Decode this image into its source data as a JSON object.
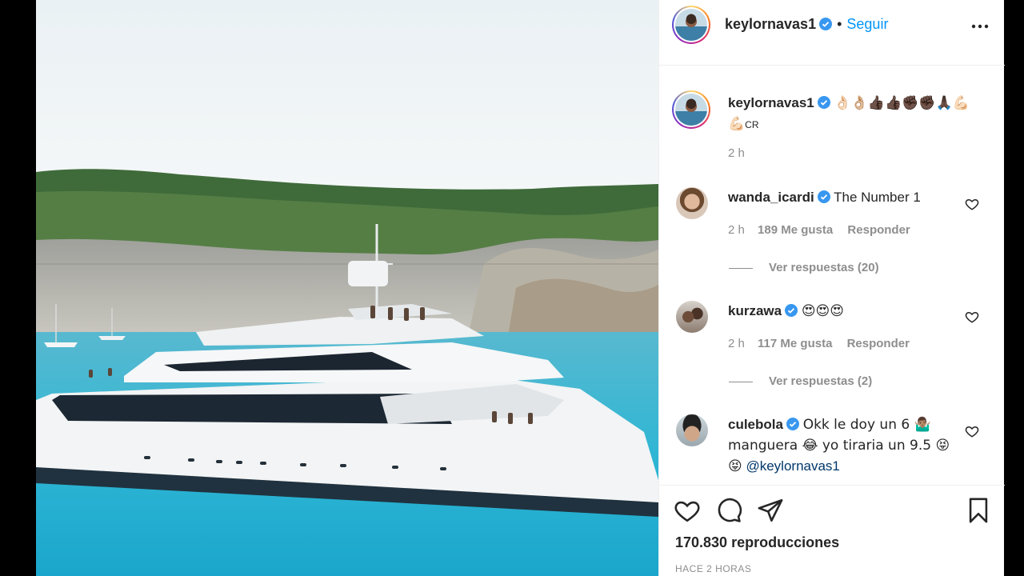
{
  "post": {
    "author": "keylornavas1",
    "follow_label": "Seguir",
    "more_icon": "more-options-icon",
    "caption_emojis": "👌🏻👌🏼👍🏿👍🏿✊🏿✊🏿🙏🏿💪🏻",
    "caption_emoji_line2": "💪🏻",
    "caption_tail": "CR",
    "caption_time": "2 h"
  },
  "comments": [
    {
      "user": "wanda_icardi",
      "text": "The Number 1",
      "time": "2 h",
      "likes": "189 Me gusta",
      "reply": "Responder",
      "view_replies": "Ver respuestas (20)"
    },
    {
      "user": "kurzawa",
      "text": "😍😍😍",
      "time": "2 h",
      "likes": "117 Me gusta",
      "reply": "Responder",
      "view_replies": "Ver respuestas (2)"
    },
    {
      "user": "culebola",
      "text_line1": "Okk le doy un 6 🤷🏽‍♂️",
      "text_line2": "manguera 😂 yo tiraria un 9.5 😝",
      "text_line3_emoji": "😝",
      "mention": "@keylornavas1"
    }
  ],
  "footer": {
    "views": "170.830 reproducciones",
    "time_ago": "HACE 2 HORAS"
  },
  "colors": {
    "accent": "#0095f6",
    "text": "#262626",
    "muted": "#8e8e8e"
  }
}
